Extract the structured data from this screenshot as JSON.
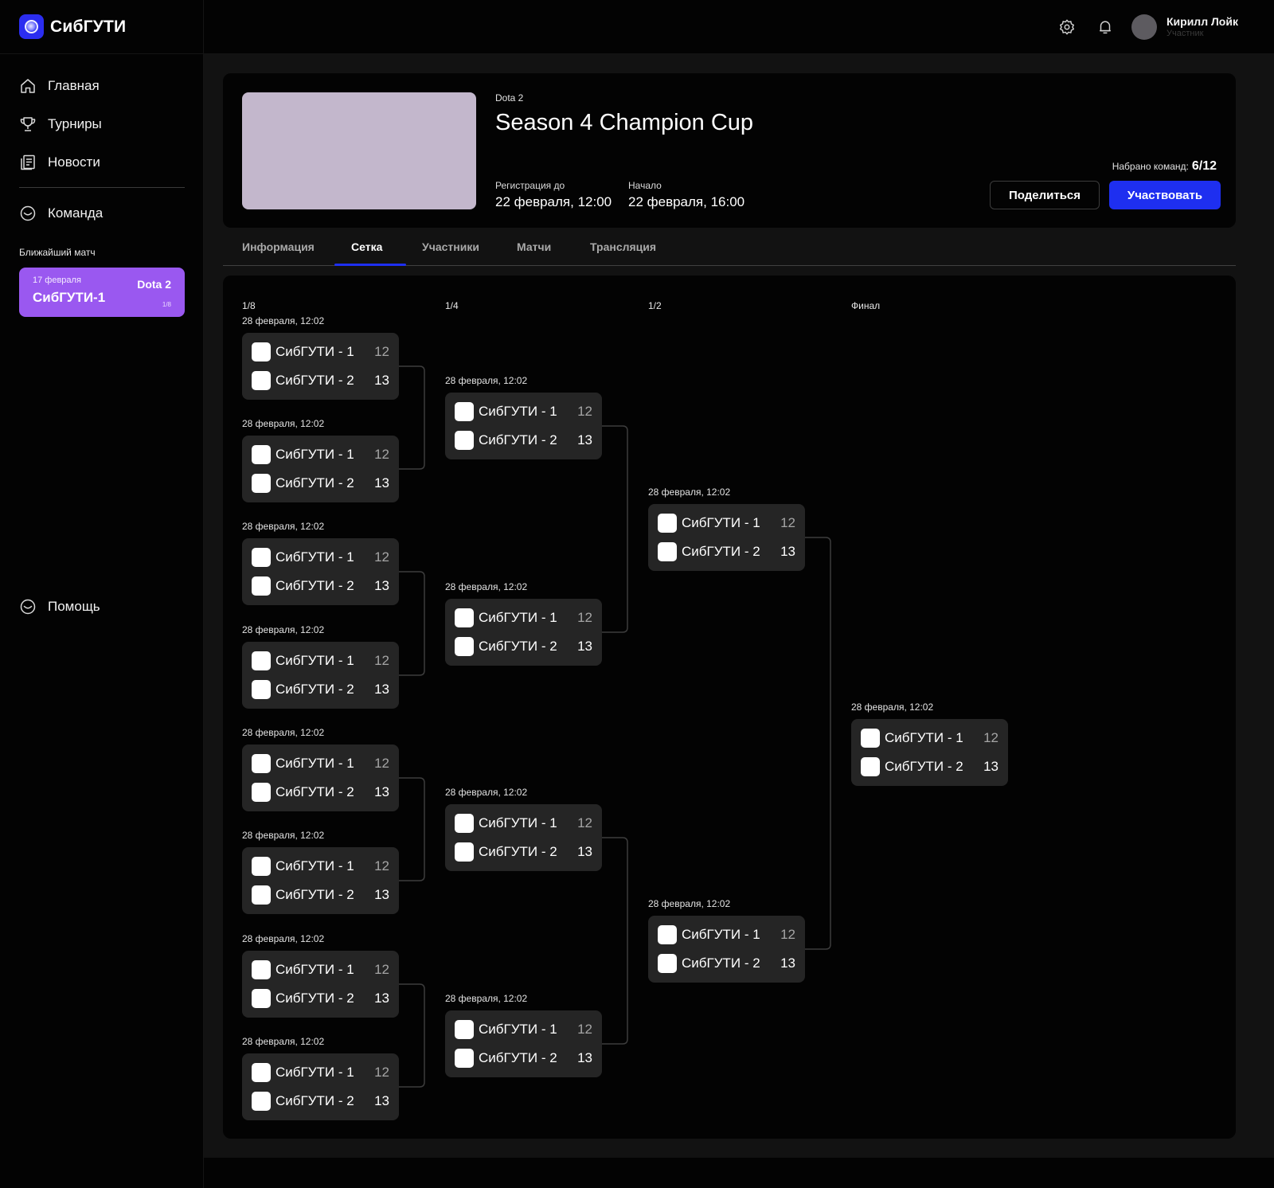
{
  "app": {
    "name": "СибГУТИ"
  },
  "sidebar": {
    "nav": [
      {
        "label": "Главная",
        "icon": "home-icon"
      },
      {
        "label": "Турниры",
        "icon": "trophy-icon"
      },
      {
        "label": "Новости",
        "icon": "news-icon"
      }
    ],
    "team_label": "Команда",
    "nearest_label": "Ближайший матч",
    "nearest_match": {
      "date": "17 февраля",
      "game": "Dota 2",
      "team": "СибГУТИ-1",
      "stage": "1/8"
    },
    "help_label": "Помощь"
  },
  "user": {
    "name": "Кирилл Лойк",
    "role": "Участник"
  },
  "tournament": {
    "game": "Dota 2",
    "title": "Season 4 Champion Cup",
    "registration_label": "Регистрация до",
    "registration_value": "22 февраля, 12:00",
    "start_label": "Начало",
    "start_value": "22 февраля, 16:00",
    "teams_label": "Набрано команд:",
    "teams_value": "6/12",
    "share_label": "Поделиться",
    "join_label": "Участвовать"
  },
  "tabs": [
    {
      "label": "Информация",
      "active": false
    },
    {
      "label": "Сетка",
      "active": true
    },
    {
      "label": "Участники",
      "active": false
    },
    {
      "label": "Матчи",
      "active": false
    },
    {
      "label": "Трансляция",
      "active": false
    }
  ],
  "bracket": {
    "rounds": [
      {
        "label": "1/8",
        "matches": [
          {
            "date": "28 февраля, 12:02",
            "team1": "СибГУТИ - 1",
            "score1": "12",
            "team2": "СибГУТИ - 2",
            "score2": "13"
          },
          {
            "date": "28 февраля, 12:02",
            "team1": "СибГУТИ - 1",
            "score1": "12",
            "team2": "СибГУТИ - 2",
            "score2": "13"
          },
          {
            "date": "28 февраля, 12:02",
            "team1": "СибГУТИ - 1",
            "score1": "12",
            "team2": "СибГУТИ - 2",
            "score2": "13"
          },
          {
            "date": "28 февраля, 12:02",
            "team1": "СибГУТИ - 1",
            "score1": "12",
            "team2": "СибГУТИ - 2",
            "score2": "13"
          },
          {
            "date": "28 февраля, 12:02",
            "team1": "СибГУТИ - 1",
            "score1": "12",
            "team2": "СибГУТИ - 2",
            "score2": "13"
          },
          {
            "date": "28 февраля, 12:02",
            "team1": "СибГУТИ - 1",
            "score1": "12",
            "team2": "СибГУТИ - 2",
            "score2": "13"
          },
          {
            "date": "28 февраля, 12:02",
            "team1": "СибГУТИ - 1",
            "score1": "12",
            "team2": "СибГУТИ - 2",
            "score2": "13"
          },
          {
            "date": "28 февраля, 12:02",
            "team1": "СибГУТИ - 1",
            "score1": "12",
            "team2": "СибГУТИ - 2",
            "score2": "13"
          }
        ]
      },
      {
        "label": "1/4",
        "matches": [
          {
            "date": "28 февраля, 12:02",
            "team1": "СибГУТИ - 1",
            "score1": "12",
            "team2": "СибГУТИ - 2",
            "score2": "13"
          },
          {
            "date": "28 февраля, 12:02",
            "team1": "СибГУТИ - 1",
            "score1": "12",
            "team2": "СибГУТИ - 2",
            "score2": "13"
          },
          {
            "date": "28 февраля, 12:02",
            "team1": "СибГУТИ - 1",
            "score1": "12",
            "team2": "СибГУТИ - 2",
            "score2": "13"
          },
          {
            "date": "28 февраля, 12:02",
            "team1": "СибГУТИ - 1",
            "score1": "12",
            "team2": "СибГУТИ - 2",
            "score2": "13"
          }
        ]
      },
      {
        "label": "1/2",
        "matches": [
          {
            "date": "28 февраля, 12:02",
            "team1": "СибГУТИ - 1",
            "score1": "12",
            "team2": "СибГУТИ - 2",
            "score2": "13"
          },
          {
            "date": "28 февраля, 12:02",
            "team1": "СибГУТИ - 1",
            "score1": "12",
            "team2": "СибГУТИ - 2",
            "score2": "13"
          }
        ]
      },
      {
        "label": "Финал",
        "matches": [
          {
            "date": "28 февраля, 12:02",
            "team1": "СибГУТИ - 1",
            "score1": "12",
            "team2": "СибГУТИ - 2",
            "score2": "13"
          }
        ]
      }
    ]
  },
  "colors": {
    "accent": "#1e2ff0",
    "nearest_card": "#9a58f0",
    "cover": "#c3b7cc",
    "match_bg": "#252525"
  }
}
